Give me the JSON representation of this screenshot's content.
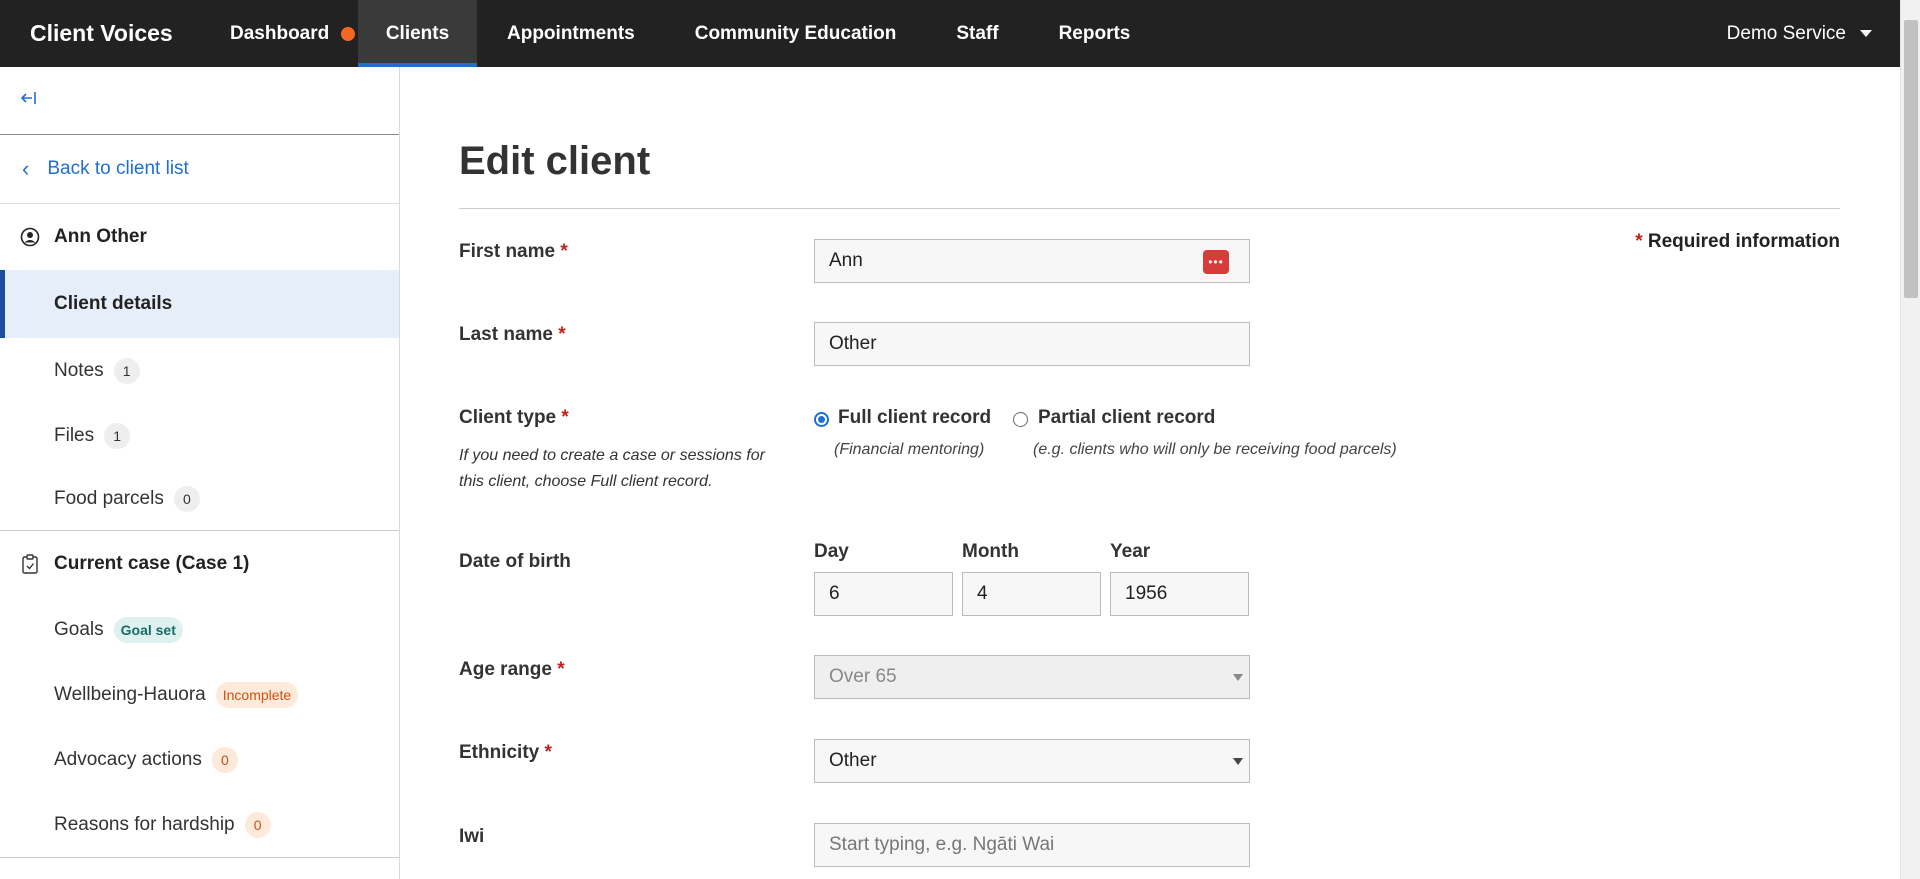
{
  "app": {
    "title": "Client Voices"
  },
  "nav": {
    "items": [
      {
        "label": "Dashboard",
        "has_alert": true
      },
      {
        "label": "Clients",
        "active": true
      },
      {
        "label": "Appointments"
      },
      {
        "label": "Community Education"
      },
      {
        "label": "Staff"
      },
      {
        "label": "Reports"
      }
    ],
    "user_menu": "Demo Service"
  },
  "sidebar": {
    "collapse_icon": "collapse-left-icon",
    "back_label": "Back to client list",
    "client_name": "Ann Other",
    "client_links": [
      {
        "label": "Client details",
        "active": true
      },
      {
        "label": "Notes",
        "badge": "1"
      },
      {
        "label": "Files",
        "badge": "1"
      },
      {
        "label": "Food parcels",
        "badge": "0"
      }
    ],
    "case_title": "Current case (Case 1)",
    "case_links": [
      {
        "label": "Goals",
        "badge": "Goal set"
      },
      {
        "label": "Wellbeing-Hauora",
        "badge": "Incomplete"
      },
      {
        "label": "Advocacy actions",
        "badge": "0"
      },
      {
        "label": "Reasons for hardship",
        "badge": "0"
      }
    ]
  },
  "form": {
    "title": "Edit client",
    "required_note": "Required information",
    "required_mark": "*",
    "first_name": {
      "label": "First name",
      "value": "Ann"
    },
    "last_name": {
      "label": "Last name",
      "value": "Other"
    },
    "client_type": {
      "label": "Client type",
      "help": "If you need to create a case or sessions for this client, choose Full client record.",
      "options": [
        {
          "label": "Full client record",
          "hint": "(Financial mentoring)",
          "checked": true
        },
        {
          "label": "Partial client record",
          "hint": "(e.g. clients who will only be receiving food parcels)",
          "checked": false
        }
      ]
    },
    "dob": {
      "label": "Date of birth",
      "day_label": "Day",
      "day": "6",
      "month_label": "Month",
      "month": "4",
      "year_label": "Year",
      "year": "1956"
    },
    "age_range": {
      "label": "Age range",
      "value": "Over 65"
    },
    "ethnicity": {
      "label": "Ethnicity",
      "value": "Other"
    },
    "iwi": {
      "label": "Iwi",
      "placeholder": "Start typing, e.g. Ngāti Wai"
    }
  },
  "colors": {
    "accent": "#1f6fd1",
    "alert_dot": "#f26722",
    "required": "#c0211c",
    "topnav_bg": "#222222"
  }
}
